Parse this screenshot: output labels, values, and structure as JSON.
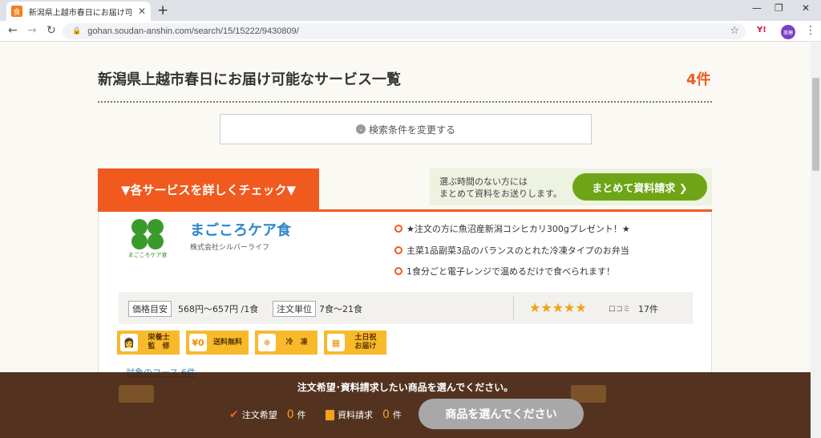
{
  "browser": {
    "tab_title": "新潟県上越市春日にお届け可能な",
    "url": "gohan.soudan-anshin.com/search/15/15222/9430809/",
    "avatar_label": "美穂",
    "ext_label": "Y!"
  },
  "page": {
    "title": "新潟県上越市春日にお届け可能なサービス一覧",
    "count": "4件",
    "search_change": "検索条件を変更する"
  },
  "check_tab": "▼各サービスを詳しくチェック▼",
  "bulk": {
    "text_line1": "選ぶ時間のない方には",
    "text_line2": "まとめて資料をお送りします。",
    "button": "まとめて資料請求 ❯"
  },
  "service": {
    "name": "まごころケア食",
    "logo_text": "まごころケア食",
    "company": "株式会社シルバーライフ",
    "features": [
      "★注文の方に魚沼産新潟コシヒカリ300gプレゼント！★",
      "主菜1品副菜3品のバランスのとれた冷凍タイプのお弁当",
      "1食分ごと電子レンジで温めるだけで食べられます！"
    ],
    "price_label": "価格目安",
    "price_value": "568円〜657円 /1食",
    "unit_label": "注文単位",
    "unit_value": "7食〜21食",
    "rating": 4.5,
    "stars": "★★★★★",
    "review_label": "口コミ",
    "review_count": "17件",
    "badges": [
      {
        "icon": "nutritionist-icon",
        "glyph": "👩",
        "line1": "栄養士",
        "line2": "監　修"
      },
      {
        "icon": "truck-icon",
        "glyph": "¥0",
        "line1": "送料無料",
        "line2": ""
      },
      {
        "icon": "frozen-icon",
        "glyph": "❄",
        "line1": "冷　凍",
        "line2": ""
      },
      {
        "icon": "calendar-icon",
        "glyph": "▦",
        "line1": "土日祝",
        "line2": "お届け"
      }
    ],
    "courses_link": "対象のコース 6件"
  },
  "footer": {
    "message": "注文希望･資料請求したい商品を選んでください。",
    "order_label": "注文希望",
    "order_count": "0",
    "order_unit": "件",
    "request_label": "資料請求",
    "request_count": "0",
    "request_unit": "件",
    "select_button": "商品を選んでください"
  },
  "colors": {
    "accent_orange": "#f05a1e",
    "link_blue": "#2f86c8",
    "green_button": "#6ea516",
    "badge_yellow": "#f8ba2b",
    "overlay_brown": "#46240e"
  }
}
